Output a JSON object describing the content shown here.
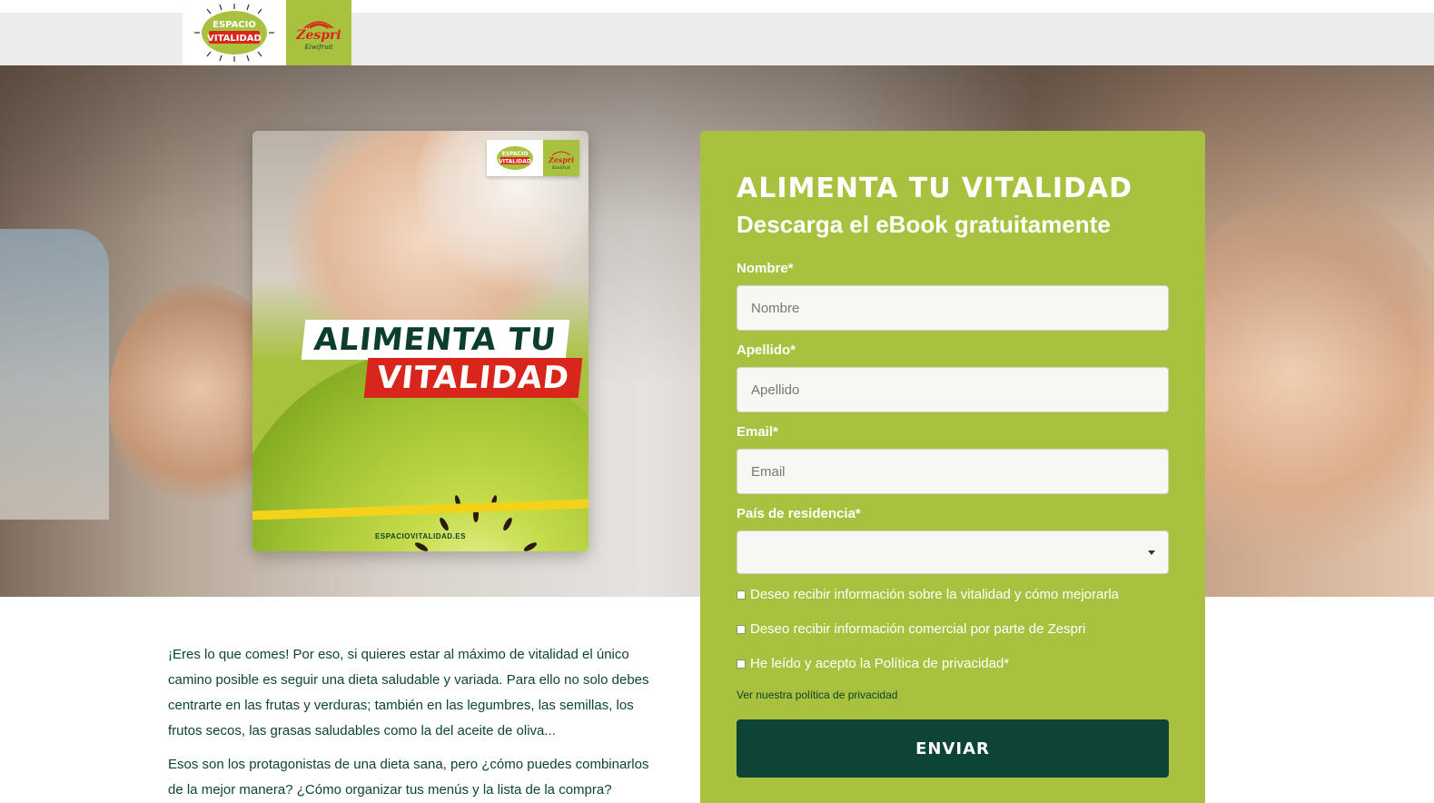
{
  "header": {
    "logo_vitalidad": {
      "line1": "ESPACIO",
      "line2": "VITALIDAD"
    },
    "logo_zespri": {
      "name": "Zespri",
      "tagline": "Kiwifruit"
    }
  },
  "cover": {
    "title_line1": "ALIMENTA TU",
    "title_line2": "VITALIDAD",
    "footer_url": "ESPACIOVITALIDAD.ES"
  },
  "form": {
    "title": "ALIMENTA TU VITALIDAD",
    "subtitle": "Descarga el eBook gratuitamente",
    "fields": {
      "nombre": {
        "label": "Nombre*",
        "placeholder": "Nombre"
      },
      "apellido": {
        "label": "Apellido*",
        "placeholder": "Apellido"
      },
      "email": {
        "label": "Email*",
        "placeholder": "Email"
      },
      "pais": {
        "label": "País de residencia*",
        "value": ""
      }
    },
    "checkboxes": [
      {
        "label": "Deseo recibir información sobre la vitalidad y cómo mejorarla",
        "checked": false
      },
      {
        "label": "Deseo recibir información comercial por parte de Zespri",
        "checked": false
      },
      {
        "label": "He leído y acepto la Política de privacidad*",
        "checked": false
      }
    ],
    "privacy_link": "Ver nuestra política de privacidad",
    "submit_label": "ENVIAR"
  },
  "content": {
    "paragraph1": "¡Eres lo que comes! Por eso, si quieres estar al máximo de vitalidad el único camino posible es seguir una dieta saludable y variada. Para ello no solo debes centrarte en las frutas y verduras; también en las legumbres, las semillas, los frutos secos, las grasas saludables como la del aceite de oliva...",
    "paragraph2": "Esos son los protagonistas de una dieta sana, pero ¿cómo puedes combinarlos de la mejor manera? ¿Cómo organizar tus menús y la lista de la compra?"
  },
  "colors": {
    "brand_green": "#a8c23f",
    "dark_green": "#0d4436",
    "accent_red": "#d9261c"
  }
}
